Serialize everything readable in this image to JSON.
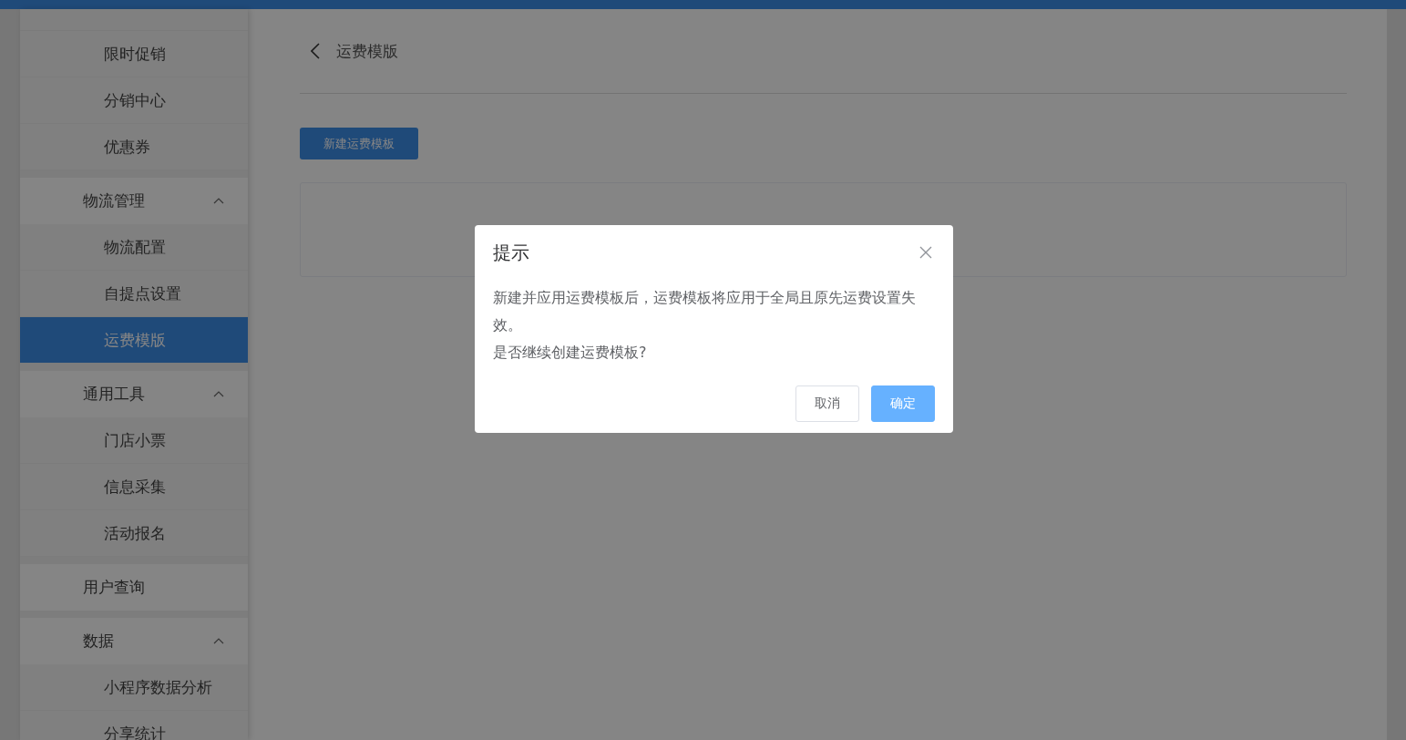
{
  "sidebar": {
    "groups": [
      {
        "kind": "list",
        "children": [
          {
            "label": "限时促销",
            "selected": false
          },
          {
            "label": "分销中心",
            "selected": false
          },
          {
            "label": "优惠券",
            "selected": false
          }
        ]
      },
      {
        "kind": "group",
        "label": "物流管理",
        "expanded": true,
        "children": [
          {
            "label": "物流配置",
            "selected": false
          },
          {
            "label": "自提点设置",
            "selected": false
          },
          {
            "label": "运费模版",
            "selected": true
          }
        ]
      },
      {
        "kind": "group",
        "label": "通用工具",
        "expanded": true,
        "children": [
          {
            "label": "门店小票",
            "selected": false
          },
          {
            "label": "信息采集",
            "selected": false
          },
          {
            "label": "活动报名",
            "selected": false
          }
        ]
      },
      {
        "kind": "link",
        "label": "用户查询"
      },
      {
        "kind": "group",
        "label": "数据",
        "expanded": true,
        "children": [
          {
            "label": "小程序数据分析",
            "selected": false
          },
          {
            "label": "分享统计",
            "selected": false
          }
        ]
      }
    ]
  },
  "page": {
    "title": "运费模版",
    "new_button": "新建运费模板"
  },
  "dialog": {
    "title": "提示",
    "message_lines": [
      "新建并应用运费模板后，运费模板将应用于全局且原先运费设置失效。",
      "是否继续创建运费模板?"
    ],
    "buttons": [
      {
        "label": "取消",
        "kind": "default"
      },
      {
        "label": "确定",
        "kind": "primary"
      }
    ]
  }
}
